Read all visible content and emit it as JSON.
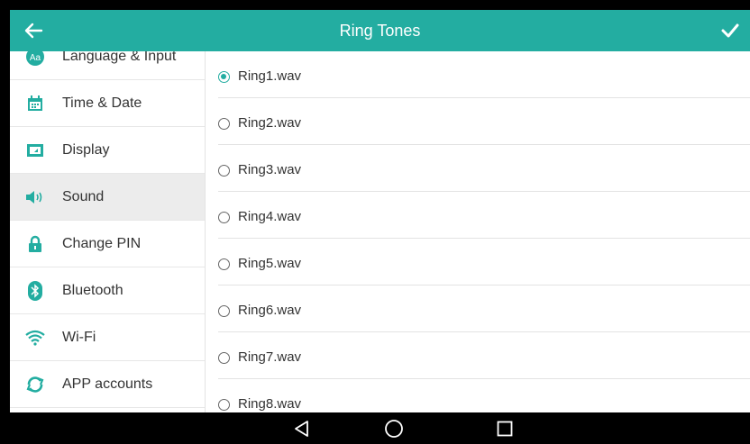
{
  "header": {
    "title": "Ring Tones",
    "back_icon": "arrow-left-icon",
    "confirm_icon": "check-icon"
  },
  "sidebar": {
    "items": [
      {
        "label": "Language & Input",
        "icon": "language-icon",
        "active": false
      },
      {
        "label": "Time & Date",
        "icon": "calendar-icon",
        "active": false
      },
      {
        "label": "Display",
        "icon": "display-icon",
        "active": false
      },
      {
        "label": "Sound",
        "icon": "speaker-icon",
        "active": true
      },
      {
        "label": "Change PIN",
        "icon": "lock-icon",
        "active": false
      },
      {
        "label": "Bluetooth",
        "icon": "bluetooth-icon",
        "active": false
      },
      {
        "label": "Wi-Fi",
        "icon": "wifi-icon",
        "active": false
      },
      {
        "label": "APP accounts",
        "icon": "sync-icon",
        "active": false
      }
    ]
  },
  "ringtones": {
    "items": [
      {
        "label": "Ring1.wav",
        "selected": true
      },
      {
        "label": "Ring2.wav",
        "selected": false
      },
      {
        "label": "Ring3.wav",
        "selected": false
      },
      {
        "label": "Ring4.wav",
        "selected": false
      },
      {
        "label": "Ring5.wav",
        "selected": false
      },
      {
        "label": "Ring6.wav",
        "selected": false
      },
      {
        "label": "Ring7.wav",
        "selected": false
      },
      {
        "label": "Ring8.wav",
        "selected": false
      }
    ]
  },
  "navbar": {
    "back": "nav-back-icon",
    "home": "nav-home-icon",
    "recents": "nav-recents-icon"
  },
  "colors": {
    "accent": "#23ada1",
    "topbar": "#23ada1",
    "active_row": "#ececec"
  }
}
